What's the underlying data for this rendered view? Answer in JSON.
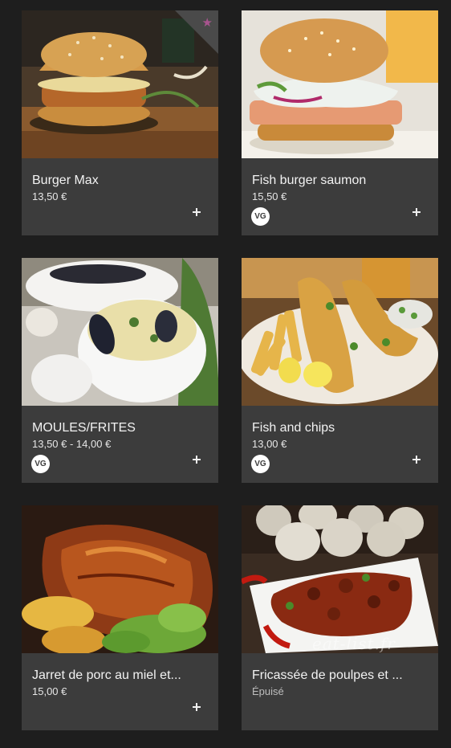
{
  "menu": {
    "items": [
      {
        "title": "Burger Max",
        "price": "13,50 €",
        "vg": false,
        "favorite": true,
        "favorite_icon": "★"
      },
      {
        "title": "Fish burger saumon",
        "price": "15,50 €",
        "vg": true,
        "vg_label": "VG"
      },
      {
        "title": "MOULES/FRITES",
        "price": "13,50 € - 14,00 €",
        "vg": true,
        "vg_label": "VG"
      },
      {
        "title": "Fish and chips",
        "price": "13,00 €",
        "vg": true,
        "vg_label": "VG"
      },
      {
        "title": "Jarret de porc au miel et...",
        "price": "15,00 €",
        "vg": false
      },
      {
        "title": "Fricassée de poulpes et ...",
        "price": "Épuisé",
        "vg": false,
        "sold_out": true,
        "watermark": "eat-list.fr"
      }
    ]
  },
  "colors": {
    "background": "#1e1e1e",
    "card": "#3c3c3c",
    "favorite_star": "#a8548e",
    "text": "#f2f2f2"
  },
  "icons": {
    "add": "plus-icon",
    "favorite": "star-icon",
    "vegetarian": "vg-badge"
  }
}
